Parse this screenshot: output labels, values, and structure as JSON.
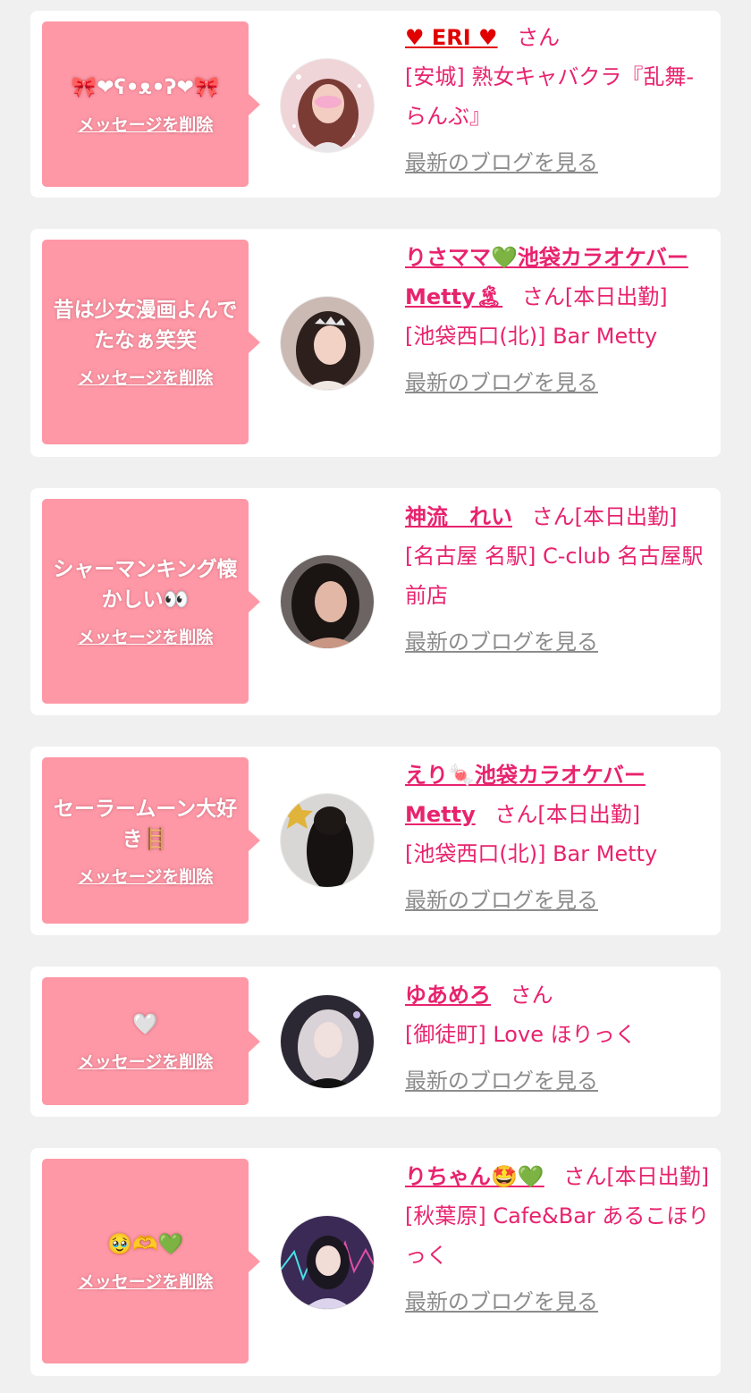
{
  "colors": {
    "page_bg": "#f0f0f0",
    "card_bg": "#ffffff",
    "bubble_bg": "#fe98a6",
    "accent_pink": "#e8236e",
    "link_gray": "#8c8c8c"
  },
  "common": {
    "delete_label": "メッセージを削除",
    "blog_label": "最新のブログを見る"
  },
  "items": [
    {
      "message": "🎀❤ʕ•ᴥ•ʔ❤🎀",
      "name": "♥ ERI ♥",
      "suffix": "さん",
      "shop": "[安城] 熟女キャバクラ『乱舞-らんぶ』",
      "avatar": "avatar-woman-pink-hair"
    },
    {
      "message": "昔は少女漫画よんでたなぁ笑笑",
      "name": "りさママ💚池袋カラオケバーMetty🏝",
      "suffix": "さん[本日出勤]",
      "shop": "[池袋西口(北)] Bar Metty",
      "avatar": "avatar-woman-tiara"
    },
    {
      "message": "シャーマンキング懐かしい👀",
      "name": "神流　れい",
      "suffix": "さん[本日出勤]",
      "shop": "[名古屋 名駅] C-club 名古屋駅前店",
      "avatar": "avatar-woman-dark-hair"
    },
    {
      "message": "セーラームーン大好き🪜",
      "name": "えり🍬池袋カラオケバーMetty",
      "suffix": "さん[本日出勤]",
      "shop": "[池袋西口(北)] Bar Metty",
      "avatar": "avatar-long-black-hair-back"
    },
    {
      "message": "🤍",
      "name": "ゆあめろ",
      "suffix": "さん",
      "shop": "[御徒町] Love ほりっく",
      "avatar": "avatar-gothic-girl"
    },
    {
      "message": "🥹🫶💚",
      "name": "りちゃん🤩💚",
      "suffix": "さん[本日出勤]",
      "shop": "[秋葉原] Cafe&Bar あるこほりっく",
      "avatar": "avatar-idol-girl"
    }
  ]
}
